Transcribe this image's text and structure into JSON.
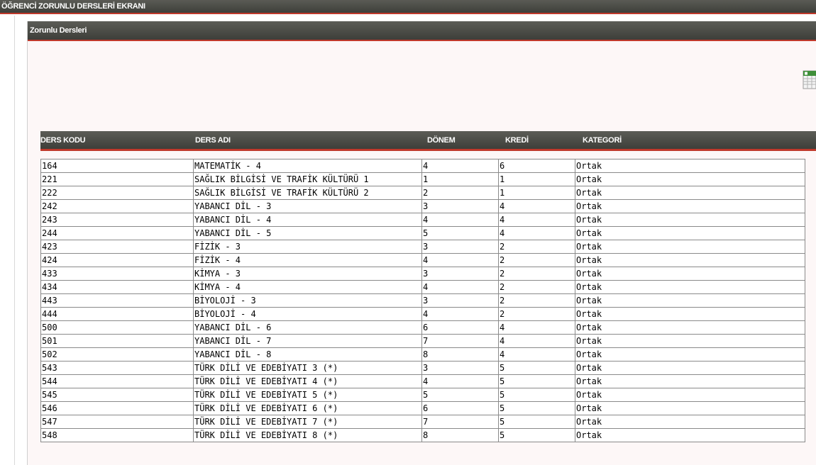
{
  "window": {
    "title": "ÖĞRENCİ ZORUNLU DERSLERİ EKRANI"
  },
  "panel": {
    "title": "Zorunlu Dersleri"
  },
  "icons": {
    "export": "excel-export-icon"
  },
  "table": {
    "headers": [
      "DERS KODU",
      "DERS ADI",
      "DÖNEM",
      "KREDİ",
      "KATEGORİ"
    ],
    "rows": [
      [
        "164",
        "MATEMATİK - 4",
        "4",
        "6",
        "Ortak"
      ],
      [
        "221",
        "SAĞLIK BİLGİSİ VE TRAFİK KÜLTÜRÜ 1",
        "1",
        "1",
        "Ortak"
      ],
      [
        "222",
        "SAĞLIK BİLGİSİ VE TRAFİK KÜLTÜRÜ 2",
        "2",
        "1",
        "Ortak"
      ],
      [
        "242",
        "YABANCI DİL - 3",
        "3",
        "4",
        "Ortak"
      ],
      [
        "243",
        "YABANCI DİL - 4",
        "4",
        "4",
        "Ortak"
      ],
      [
        "244",
        "YABANCI DİL - 5",
        "5",
        "4",
        "Ortak"
      ],
      [
        "423",
        "FİZİK - 3",
        "3",
        "2",
        "Ortak"
      ],
      [
        "424",
        "FİZİK - 4",
        "4",
        "2",
        "Ortak"
      ],
      [
        "433",
        "KİMYA - 3",
        "3",
        "2",
        "Ortak"
      ],
      [
        "434",
        "KİMYA - 4",
        "4",
        "2",
        "Ortak"
      ],
      [
        "443",
        "BİYOLOJİ - 3",
        "3",
        "2",
        "Ortak"
      ],
      [
        "444",
        "BİYOLOJİ - 4",
        "4",
        "2",
        "Ortak"
      ],
      [
        "500",
        "YABANCI DİL - 6",
        "6",
        "4",
        "Ortak"
      ],
      [
        "501",
        "YABANCI DİL - 7",
        "7",
        "4",
        "Ortak"
      ],
      [
        "502",
        "YABANCI DİL - 8",
        "8",
        "4",
        "Ortak"
      ],
      [
        "543",
        "TÜRK DİLİ VE EDEBİYATI 3 (*)",
        "3",
        "5",
        "Ortak"
      ],
      [
        "544",
        "TÜRK DİLİ VE EDEBİYATI 4 (*)",
        "4",
        "5",
        "Ortak"
      ],
      [
        "545",
        "TÜRK DİLİ VE EDEBİYATI 5 (*)",
        "5",
        "5",
        "Ortak"
      ],
      [
        "546",
        "TÜRK DİLİ VE EDEBİYATI 6 (*)",
        "6",
        "5",
        "Ortak"
      ],
      [
        "547",
        "TÜRK DİLİ VE EDEBİYATI 7 (*)",
        "7",
        "5",
        "Ortak"
      ],
      [
        "548",
        "TÜRK DİLİ VE EDEBİYATI 8 (*)",
        "8",
        "5",
        "Ortak"
      ]
    ]
  }
}
